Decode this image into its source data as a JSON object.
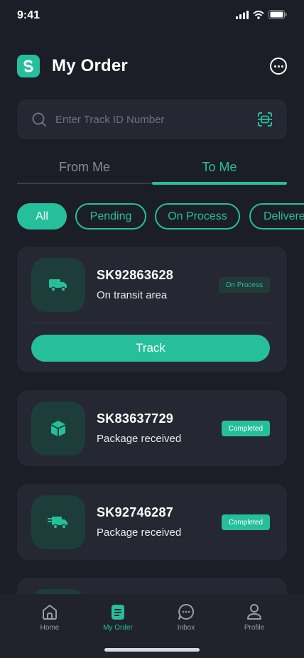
{
  "status_bar": {
    "time": "9:41"
  },
  "header": {
    "title": "My Order"
  },
  "search": {
    "placeholder": "Enter Track ID Number"
  },
  "tabs": [
    {
      "label": "From Me"
    },
    {
      "label": "To Me"
    }
  ],
  "filters": [
    {
      "label": "All"
    },
    {
      "label": "Pending"
    },
    {
      "label": "On Process"
    },
    {
      "label": "Delivered"
    }
  ],
  "orders": [
    {
      "id": "SK92863628",
      "status_text": "On transit area",
      "badge": "On Process",
      "action": "Track",
      "icon": "truck-icon"
    },
    {
      "id": "SK83637729",
      "status_text": "Package received",
      "badge": "Completed",
      "icon": "box-icon"
    },
    {
      "id": "SK92746287",
      "status_text": "Package received",
      "badge": "Completed",
      "icon": "fast-truck-icon"
    }
  ],
  "nav": [
    {
      "label": "Home",
      "icon": "home-icon"
    },
    {
      "label": "My Order",
      "icon": "order-icon"
    },
    {
      "label": "Inbox",
      "icon": "chat-icon"
    },
    {
      "label": "Profile",
      "icon": "profile-icon"
    }
  ],
  "colors": {
    "accent": "#26bf9b",
    "background": "#1b1e26",
    "card": "#252832"
  }
}
